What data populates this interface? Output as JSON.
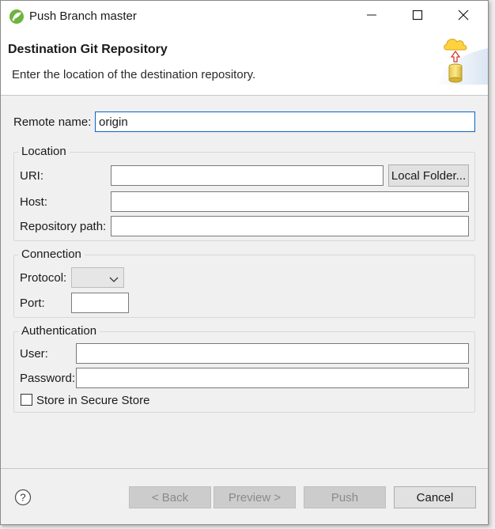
{
  "window": {
    "title": "Push Branch master",
    "icons": {
      "app": "eclipse-spring-icon",
      "minimize": "minimize-icon",
      "maximize": "maximize-icon",
      "close": "close-icon"
    }
  },
  "banner": {
    "title": "Destination Git Repository",
    "description": "Enter the location of the destination repository.",
    "art_icon": "cloud-repository-icon"
  },
  "form": {
    "remote_name": {
      "label": "Remote name:",
      "value": "origin"
    },
    "location": {
      "legend": "Location",
      "uri_label": "URI:",
      "uri_value": "",
      "local_folder_button": "Local Folder...",
      "host_label": "Host:",
      "host_value": "",
      "repo_path_label": "Repository path:",
      "repo_path_value": ""
    },
    "connection": {
      "legend": "Connection",
      "protocol_label": "Protocol:",
      "protocol_value": "",
      "port_label": "Port:",
      "port_value": ""
    },
    "authentication": {
      "legend": "Authentication",
      "user_label": "User:",
      "user_value": "",
      "password_label": "Password:",
      "password_value": "",
      "store_label": "Store in Secure Store",
      "store_checked": false
    }
  },
  "footer": {
    "help_icon": "help-icon",
    "back_label": "< Back",
    "preview_label": "Preview >",
    "push_label": "Push",
    "cancel_label": "Cancel"
  },
  "colors": {
    "accent_focus": "#0a64c8",
    "background": "#f0f0f0",
    "disabled_button": "#cccccc"
  }
}
